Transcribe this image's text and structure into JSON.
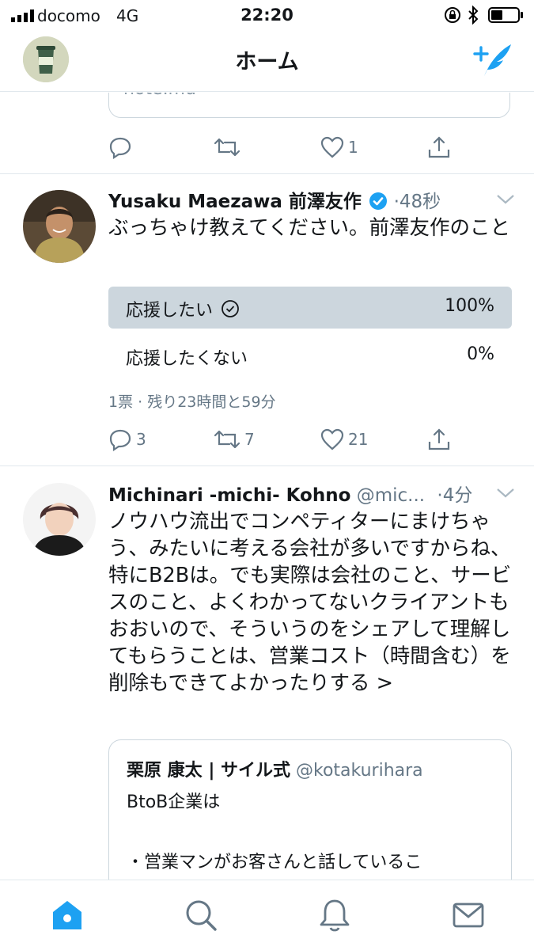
{
  "status_bar": {
    "carrier": "docomo",
    "network": "4G",
    "time": "22:20"
  },
  "nav": {
    "title": "ホーム",
    "accent_color": "#1da1f2"
  },
  "previous_tweet": {
    "card_text": "note.mu",
    "replies": "",
    "retweets": "",
    "likes": "1"
  },
  "tweets": [
    {
      "name": "Yusaku Maezawa 前澤友作",
      "verified": true,
      "handle": "",
      "time": "·48秒",
      "text": "ぶっちゃけ教えてください。前澤友作のこと",
      "poll": {
        "options": [
          {
            "label": "応援したい",
            "percent": "100%",
            "selected": true
          },
          {
            "label": "応援したくない",
            "percent": "0%",
            "selected": false
          }
        ],
        "meta": "1票 · 残り23時間と59分"
      },
      "replies": "3",
      "retweets": "7",
      "likes": "21"
    },
    {
      "name": "Michinari -michi- Kohno",
      "handle": "@mic...",
      "time": "·4分",
      "text": "ノウハウ流出でコンペティターにまけちゃう、みたいに考える会社が多いですからね、特にB2Bは。でも実際は会社のこと、サービスのこと、よくわかってないクライアントもおおいので、そういうのをシェアして理解してもらうことは、営業コスト（時間含む）を削除もできてよかったりする >",
      "quoted": {
        "name": "栗原 康太 | サイル式",
        "handle": "@kotakurihara",
        "text": "BtoB企業は\n\n・営業マンがお客さんと話しているこ\nと"
      }
    }
  ],
  "tabs": [
    "home",
    "search",
    "notifications",
    "messages"
  ]
}
